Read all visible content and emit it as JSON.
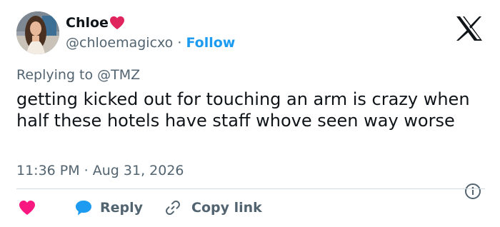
{
  "author": {
    "display_name": "Chloe",
    "handle": "@chloemagicxo",
    "separator": " · ",
    "follow_label": "Follow"
  },
  "reply_context": {
    "prefix": "Replying to ",
    "mention": "@TMZ"
  },
  "tweet": {
    "text": "getting kicked out for touching an arm is crazy when half these hotels have staff whove seen way worse",
    "timestamp": "11:36 PM · Aug 31, 2026"
  },
  "actions": {
    "reply_label": "Reply",
    "copy_link_label": "Copy link"
  },
  "icons": {
    "logo": "x-logo-icon",
    "badge": "red-heart-icon",
    "info": "info-icon",
    "like": "heart-icon",
    "reply": "speech-bubble-icon",
    "copy": "link-icon"
  },
  "colors": {
    "accent": "#1d9bf0",
    "heart": "#f91880",
    "badge_heart": "#e0245e",
    "muted_text": "#536471",
    "text": "#0f1419",
    "divider": "#cfd9de"
  }
}
